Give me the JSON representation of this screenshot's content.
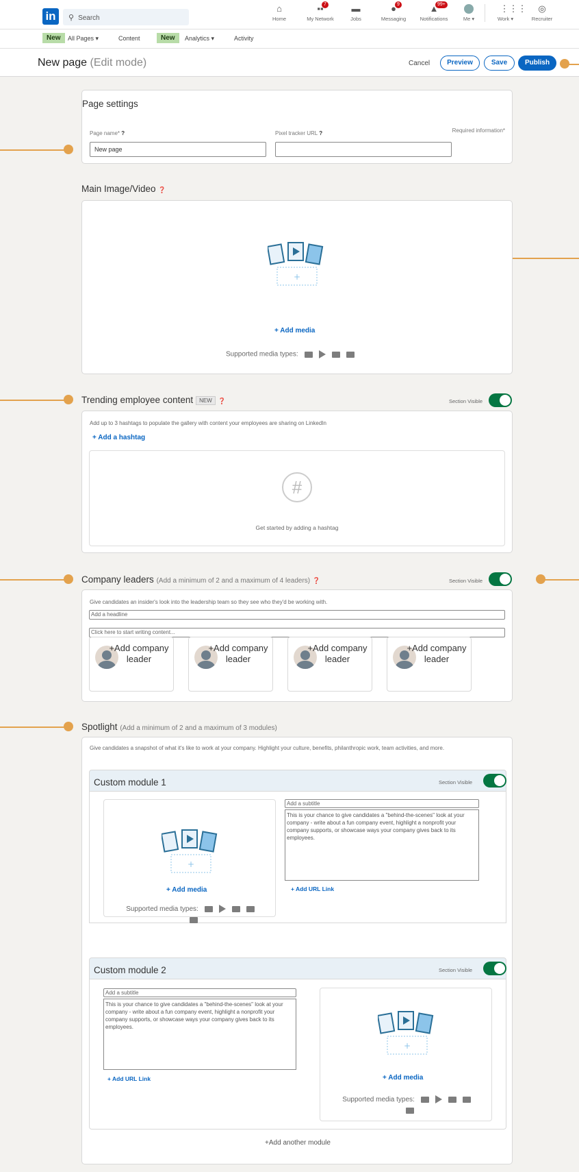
{
  "topnav": {
    "search_placeholder": "Search",
    "items": [
      {
        "label": "Home",
        "badge": ""
      },
      {
        "label": "My Network",
        "badge": "7"
      },
      {
        "label": "Jobs",
        "badge": ""
      },
      {
        "label": "Messaging",
        "badge": "9"
      },
      {
        "label": "Notifications",
        "badge": "99+"
      },
      {
        "label": "Me ▾",
        "badge": ""
      },
      {
        "label": "Work ▾",
        "badge": ""
      },
      {
        "label": "Recruiter",
        "badge": ""
      }
    ]
  },
  "subnav": {
    "new1": "New",
    "all_pages": "All Pages ▾",
    "content": "Content",
    "new2": "New",
    "analytics": "Analytics ▾",
    "activity": "Activity"
  },
  "header": {
    "title": "New page",
    "mode": "(Edit mode)",
    "cancel": "Cancel",
    "preview": "Preview",
    "save": "Save",
    "publish": "Publish"
  },
  "page_settings": {
    "title": "Page settings",
    "name_label": "Page name*",
    "name_value": "New page",
    "pixel_label": "Pixel tracker URL",
    "required": "Required information*"
  },
  "main_media": {
    "title": "Main Image/Video",
    "add_media": "+ Add media",
    "supported": "Supported media types:"
  },
  "trending": {
    "title": "Trending employee content",
    "new_badge": "NEW",
    "visible": "Section Visible",
    "help": "Add up to 3 hashtags to populate the gallery with content your employees are sharing on LinkedIn",
    "add_hashtag": "+ Add a hashtag",
    "empty": "Get started by adding a hashtag"
  },
  "leaders": {
    "title": "Company leaders",
    "sub": "(Add a minimum of 2 and a maximum of 4 leaders)",
    "visible": "Section Visible",
    "help": "Give candidates an insider's look into the leadership team so they see who they'd be working with.",
    "headline_placeholder": "Add a headline",
    "content_placeholder": "Click here to start writing content...",
    "card_label": "Add company leader"
  },
  "spotlight": {
    "title": "Spotlight",
    "sub": "(Add a minimum of 2 and a maximum of 3 modules)",
    "help": "Give candidates a snapshot of what it's like to work at your company. Highlight your culture, benefits, philanthropic work, team activities, and more.",
    "modules": [
      {
        "title": "Custom module 1",
        "visible": "Section Visible",
        "subtitle": "Add a subtitle",
        "body": "This is your chance to give candidates a \"behind-the-scenes\" look at your company - write about a fun company event, highlight a nonprofit your company supports, or showcase ways your company gives back to its employees.",
        "add_url": "+ Add URL Link",
        "add_media": "+ Add media",
        "supported": "Supported media types:"
      },
      {
        "title": "Custom module 2",
        "visible": "Section Visible",
        "subtitle": "Add a subtitle",
        "body": "This is your chance to give candidates a \"behind-the-scenes\" look at your company - write about a fun company event, highlight a nonprofit your company supports, or showcase ways your company gives back to its employees.",
        "add_url": "+ Add URL Link",
        "add_media": "+ Add media",
        "supported": "Supported media types:"
      }
    ],
    "add_module": "+Add another module"
  },
  "colors": {
    "brand": "#0a66c2",
    "callout": "#e3a24d",
    "toggle_on": "#057642"
  }
}
